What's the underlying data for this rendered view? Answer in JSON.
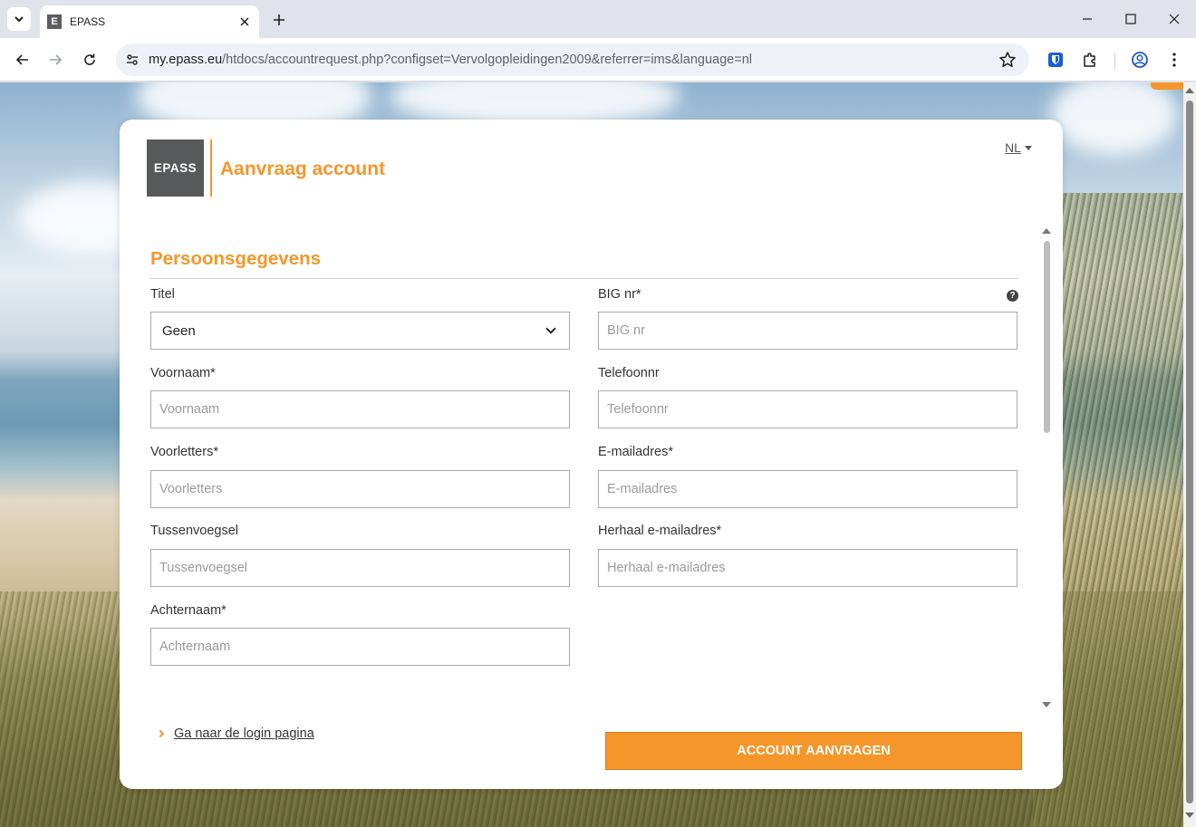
{
  "browser": {
    "tab_title": "EPASS",
    "favicon_letter": "E",
    "url_host": "my.epass.eu",
    "url_path": "/htdocs/accountrequest.php?configset=Vervolgopleidingen2009&referrer=ims&language=nl"
  },
  "header": {
    "logo_text": "EPASS",
    "title": "Aanvraag account",
    "language": "NL"
  },
  "section": {
    "title": "Persoonsgegevens"
  },
  "form": {
    "titel": {
      "label": "Titel",
      "value": "Geen"
    },
    "big": {
      "label": "BIG nr*",
      "placeholder": "BIG nr"
    },
    "voornaam": {
      "label": "Voornaam*",
      "placeholder": "Voornaam"
    },
    "telefoon": {
      "label": "Telefoonnr",
      "placeholder": "Telefoonnr"
    },
    "voorletters": {
      "label": "Voorletters*",
      "placeholder": "Voorletters"
    },
    "email": {
      "label": "E-mailadres*",
      "placeholder": "E-mailadres"
    },
    "tussenvoegsel": {
      "label": "Tussenvoegsel",
      "placeholder": "Tussenvoegsel"
    },
    "email_repeat": {
      "label": "Herhaal e-mailadres*",
      "placeholder": "Herhaal e-mailadres"
    },
    "achternaam": {
      "label": "Achternaam*",
      "placeholder": "Achternaam"
    }
  },
  "footer": {
    "login_link": "Ga naar de login pagina",
    "submit": "ACCOUNT AANVRAGEN"
  },
  "colors": {
    "accent": "#f5962a",
    "logo_bg": "#58595b"
  }
}
